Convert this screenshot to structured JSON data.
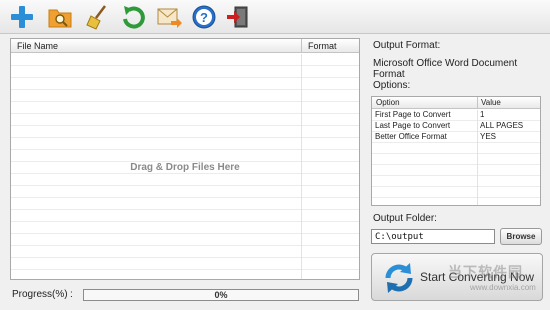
{
  "toolbar": {
    "buttons": [
      {
        "icon": "add-icon"
      },
      {
        "icon": "folder-search-icon"
      },
      {
        "icon": "broom-icon"
      },
      {
        "icon": "refresh-arrow-icon"
      },
      {
        "icon": "mail-forward-icon"
      },
      {
        "icon": "help-icon",
        "glyph": "?"
      },
      {
        "icon": "exit-icon"
      }
    ]
  },
  "file_list": {
    "columns": [
      "File Name",
      "Format"
    ],
    "drag_hint": "Drag & Drop Files Here"
  },
  "progress": {
    "label": "Progress(%)",
    "colon": ":",
    "value_text": "0%",
    "fraction": 0
  },
  "output_format": {
    "label": "Output Format:",
    "value": "Microsoft Office Word Document Format"
  },
  "options": {
    "label": "Options:",
    "columns": [
      "Option",
      "Value"
    ],
    "rows": [
      {
        "option": "First Page to Convert",
        "value": "1"
      },
      {
        "option": "Last Page to Convert",
        "value": "ALL PAGES"
      },
      {
        "option": "Better Office Format",
        "value": "YES"
      }
    ]
  },
  "output_folder": {
    "label": "Output Folder:",
    "value": "C:\\output",
    "browse_label": "Browse"
  },
  "convert": {
    "label": "Start Converting Now"
  },
  "watermark": {
    "cn": "当下软件园",
    "url": "www.downxia.com"
  },
  "colors": {
    "accent_blue": "#2a8fd6",
    "folder_orange": "#f0a030",
    "green": "#2e9a3a",
    "exit_red": "#cc2020"
  }
}
